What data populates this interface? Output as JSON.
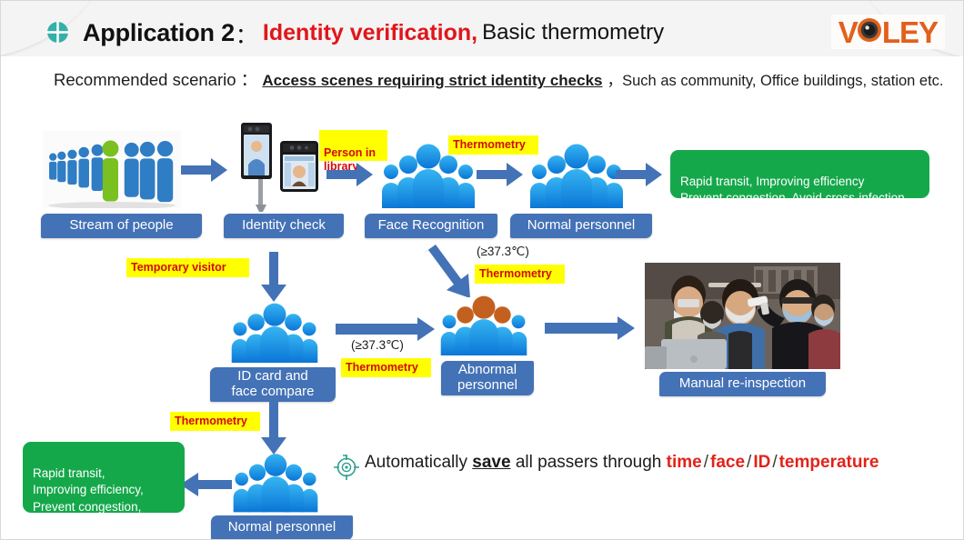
{
  "header": {
    "app_label": "Application 2",
    "colon": "：",
    "highlight": "Identity verification,",
    "rest": "Basic thermometry",
    "logo_text_1": "V",
    "logo_text_2": "LEY",
    "logo_name": "VCLEY",
    "bullet_icon": "circle-cross-icon",
    "accent_teal": "#30b3ac",
    "accent_red": "#e0161a",
    "accent_orange": "#e2601b"
  },
  "scenario": {
    "prefix": "Recommended scenario ：",
    "strong": "Access scenes requiring strict identity checks",
    "tail": "，Such as community, Office buildings, station etc."
  },
  "flow": {
    "chips": {
      "stream_of_people": "Stream of people",
      "identity_check": "Identity check",
      "face_recognition": "Face Recognition",
      "normal_personnel_top": "Normal personnel",
      "id_card_face_compare": "ID card and\nface compare",
      "abnormal_personnel": "Abnormal\npersonnel",
      "manual_reinspection": "Manual re-inspection",
      "normal_personnel_bottom": "Normal personnel"
    },
    "yellow_labels": {
      "person_in_library": "Person in\nlibrary",
      "thermometry_1": "Thermometry",
      "temporary_visitor": "Temporary visitor",
      "thermometry_2": "Thermometry",
      "thermometry_3": "Thermometry",
      "thermometry_4": "Thermometry"
    },
    "temp_notes": {
      "note_top": "(≥37.3℃)",
      "note_mid": "(≥37.3℃)"
    },
    "green_boxes": {
      "top": "Rapid transit, Improving efficiency\nPrevent congestion, Avoid cross-infection",
      "bottom": "Rapid transit,\nImproving efficiency,\nPrevent congestion,\nAvoid cross-infection."
    },
    "colors": {
      "chip_blue": "#4472b6",
      "arrow_blue": "#4472b6",
      "yellow": "#ffff00",
      "label_red": "#d40a0a",
      "green": "#15a84b",
      "people_blue": "#1f9cf0",
      "people_orange": "#c4601f"
    }
  },
  "footer": {
    "target_icon": "target-crosshair-icon",
    "text_1": "Automatically ",
    "save": "save",
    "text_2": " all passers through ",
    "kw_time": "time",
    "kw_face": "face",
    "kw_id": "ID",
    "kw_temperature": "temperature",
    "separator": "/"
  }
}
